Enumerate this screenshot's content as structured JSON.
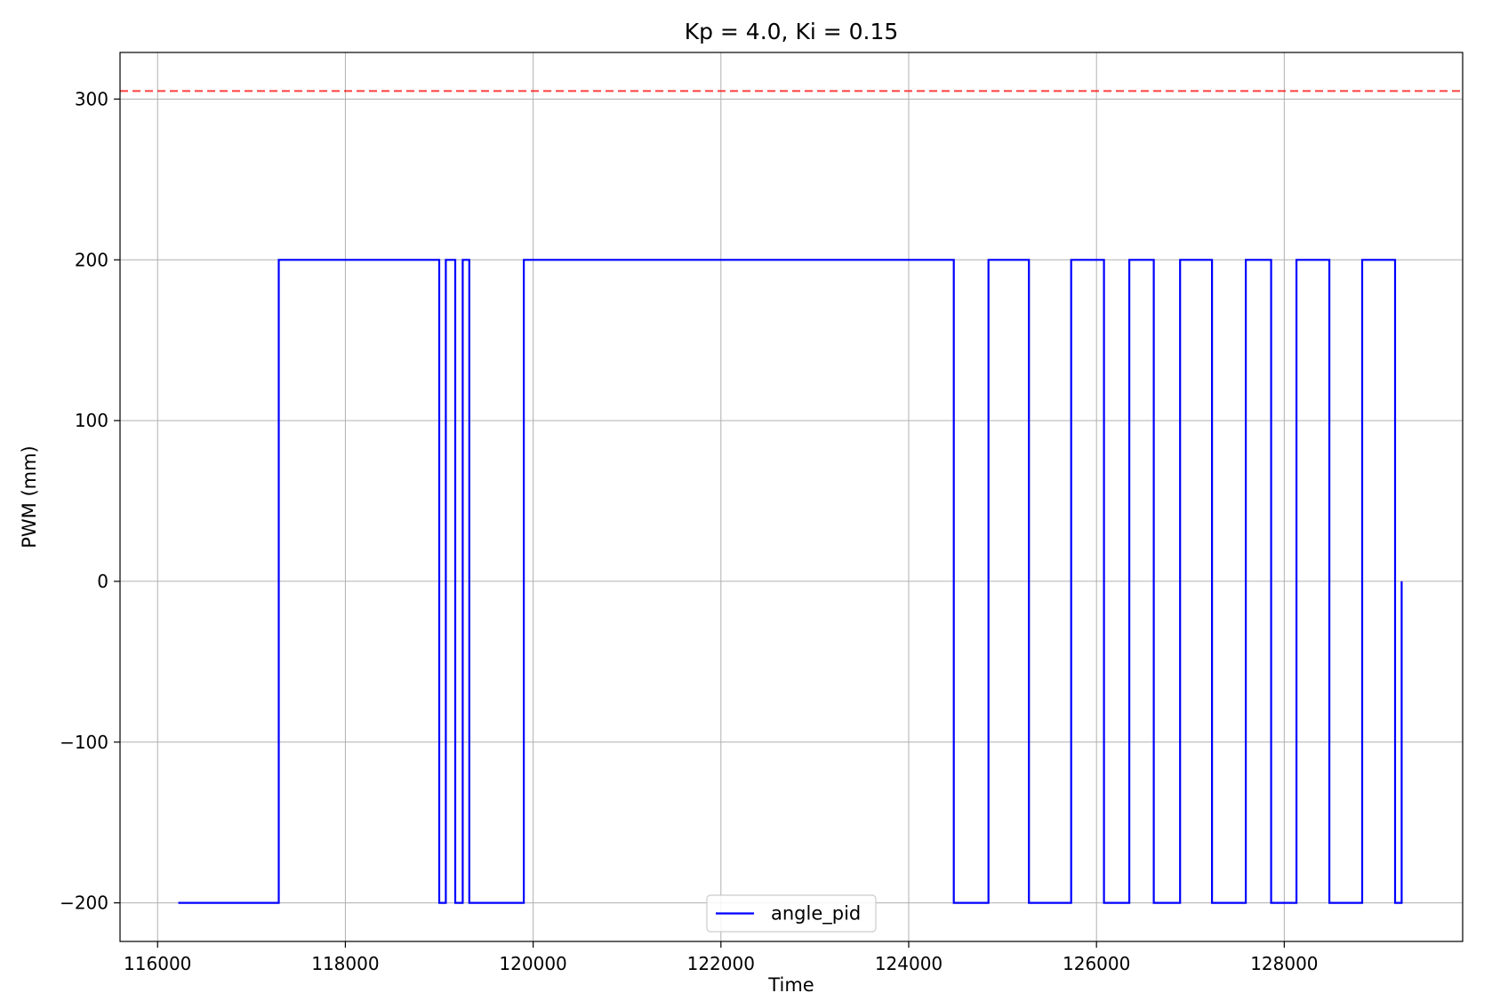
{
  "chart_data": {
    "type": "line",
    "title": "Kp = 4.0, Ki = 0.15",
    "xlabel": "Time",
    "ylabel": "PWM (mm)",
    "xlim": [
      115600,
      129900
    ],
    "ylim": [
      -224,
      329
    ],
    "xticks": [
      116000,
      118000,
      120000,
      122000,
      124000,
      126000,
      128000
    ],
    "xtick_labels": [
      "116000",
      "118000",
      "120000",
      "122000",
      "124000",
      "126000",
      "128000"
    ],
    "yticks": [
      -200,
      -100,
      0,
      100,
      200,
      300
    ],
    "ytick_labels": [
      "−200",
      "−100",
      "0",
      "100",
      "200",
      "300"
    ],
    "grid": true,
    "legend": {
      "placement": "bottom-center",
      "entries": [
        "angle_pid"
      ]
    },
    "colors": {
      "series": "#0000ff",
      "reference": "#ff0000",
      "grid": "#b0b0b0"
    },
    "reference_line": {
      "y": 305,
      "style": "dashed",
      "color": "#ff0000"
    },
    "series": [
      {
        "name": "angle_pid",
        "color": "#0000ff",
        "x": [
          116220,
          117290,
          117290,
          119000,
          119000,
          119070,
          119070,
          119170,
          119170,
          119250,
          119250,
          119320,
          119320,
          119380,
          119380,
          119900,
          119900,
          124480,
          124480,
          124850,
          124850,
          125280,
          125280,
          125730,
          125730,
          126080,
          126080,
          126350,
          126350,
          126610,
          126610,
          126890,
          126890,
          127230,
          127230,
          127590,
          127590,
          127860,
          127860,
          128130,
          128130,
          128480,
          128480,
          128830,
          128830,
          129180,
          129180,
          129250,
          129250
        ],
        "y": [
          -200,
          -200,
          200,
          200,
          -200,
          -200,
          200,
          200,
          -200,
          -200,
          200,
          200,
          -200,
          -200,
          -200,
          -200,
          200,
          200,
          -200,
          -200,
          200,
          200,
          -200,
          -200,
          200,
          200,
          -200,
          -200,
          200,
          200,
          -200,
          -200,
          200,
          200,
          -200,
          -200,
          200,
          200,
          -200,
          -200,
          200,
          200,
          -200,
          -200,
          200,
          200,
          -200,
          -200,
          0
        ]
      }
    ]
  }
}
